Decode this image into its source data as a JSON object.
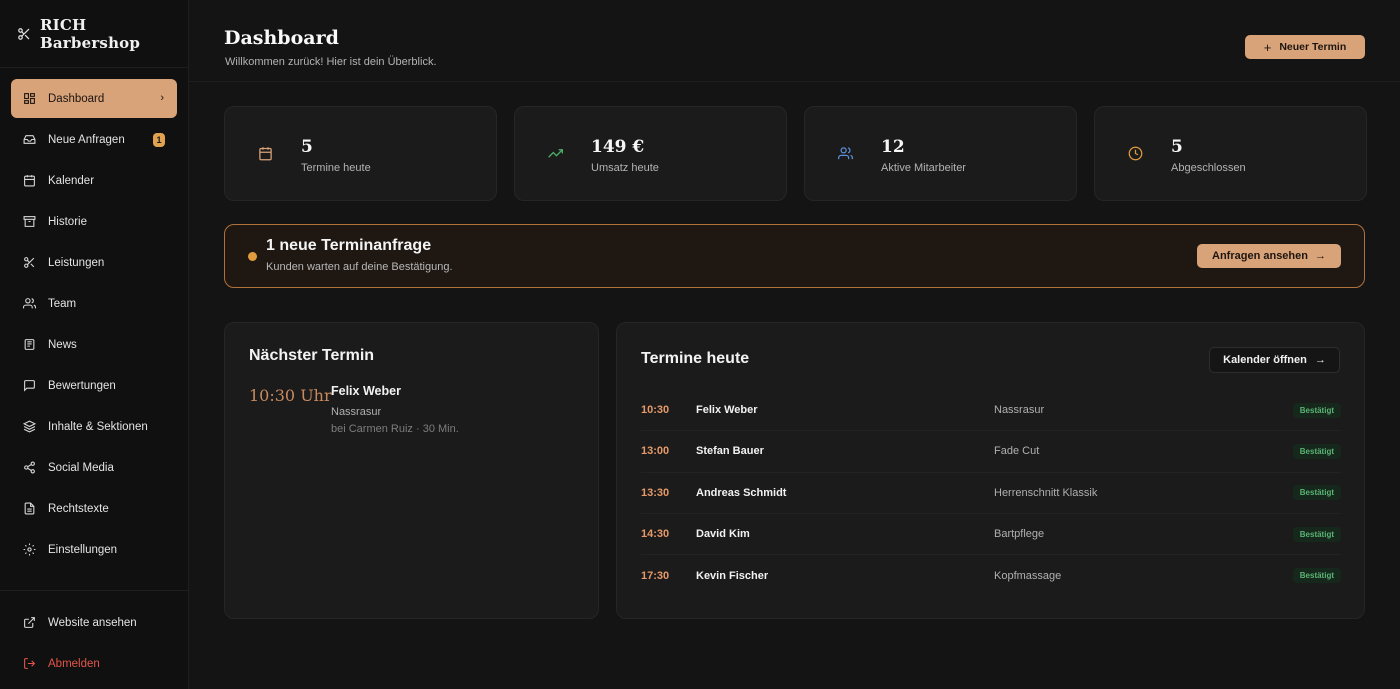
{
  "brand": {
    "name": "RICH Barbershop",
    "icon": "scissors-icon"
  },
  "sidebar": {
    "items": [
      {
        "label": "Dashboard",
        "icon": "dashboard-icon",
        "active": true
      },
      {
        "label": "Neue Anfragen",
        "icon": "inbox-icon",
        "badge": "1"
      },
      {
        "label": "Kalender",
        "icon": "calendar-icon"
      },
      {
        "label": "Historie",
        "icon": "archive-icon"
      },
      {
        "label": "Leistungen",
        "icon": "scissors-icon"
      },
      {
        "label": "Team",
        "icon": "users-icon"
      },
      {
        "label": "News",
        "icon": "newspaper-icon"
      },
      {
        "label": "Bewertungen",
        "icon": "message-icon"
      },
      {
        "label": "Inhalte & Sektionen",
        "icon": "layers-icon"
      },
      {
        "label": "Social Media",
        "icon": "share-icon"
      },
      {
        "label": "Rechtstexte",
        "icon": "document-icon"
      },
      {
        "label": "Einstellungen",
        "icon": "gear-icon"
      }
    ],
    "bottom": [
      {
        "label": "Website ansehen",
        "icon": "external-link-icon"
      },
      {
        "label": "Abmelden",
        "icon": "logout-icon"
      }
    ]
  },
  "header": {
    "title": "Dashboard",
    "subtitle": "Willkommen zurück! Hier ist dein Überblick.",
    "new_button": "Neuer Termin"
  },
  "stats": [
    {
      "value": "5",
      "label": "Termine heute",
      "icon": "calendar-icon",
      "color": "#d9a37a"
    },
    {
      "value": "149 €",
      "label": "Umsatz heute",
      "icon": "trending-up-icon",
      "color": "#4caf6a"
    },
    {
      "value": "12",
      "label": "Aktive Mitarbeiter",
      "icon": "users-icon",
      "color": "#5b8fd9"
    },
    {
      "value": "5",
      "label": "Abgeschlossen",
      "icon": "clock-icon",
      "color": "#e19b3f"
    }
  ],
  "alert": {
    "title": "1 neue Terminanfrage",
    "subtitle": "Kunden warten auf deine Bestätigung.",
    "button": "Anfragen ansehen"
  },
  "next": {
    "heading": "Nächster Termin",
    "time": "10:30 Uhr",
    "name": "Felix Weber",
    "service": "Nassrasur",
    "meta": "bei Carmen Ruiz · 30 Min."
  },
  "today": {
    "heading": "Termine heute",
    "button": "Kalender öffnen",
    "rows": [
      {
        "time": "10:30",
        "name": "Felix Weber",
        "service": "Nassrasur",
        "status": "Bestätigt"
      },
      {
        "time": "13:00",
        "name": "Stefan Bauer",
        "service": "Fade Cut",
        "status": "Bestätigt"
      },
      {
        "time": "13:30",
        "name": "Andreas Schmidt",
        "service": "Herrenschnitt Klassik",
        "status": "Bestätigt"
      },
      {
        "time": "14:30",
        "name": "David Kim",
        "service": "Bartpflege",
        "status": "Bestätigt"
      },
      {
        "time": "17:30",
        "name": "Kevin Fischer",
        "service": "Kopfmassage",
        "status": "Bestätigt"
      }
    ]
  },
  "colors": {
    "accent": "#d9a37a",
    "alert_border": "#b0713a",
    "status_green": "#5bb374",
    "danger": "#e2564a"
  }
}
